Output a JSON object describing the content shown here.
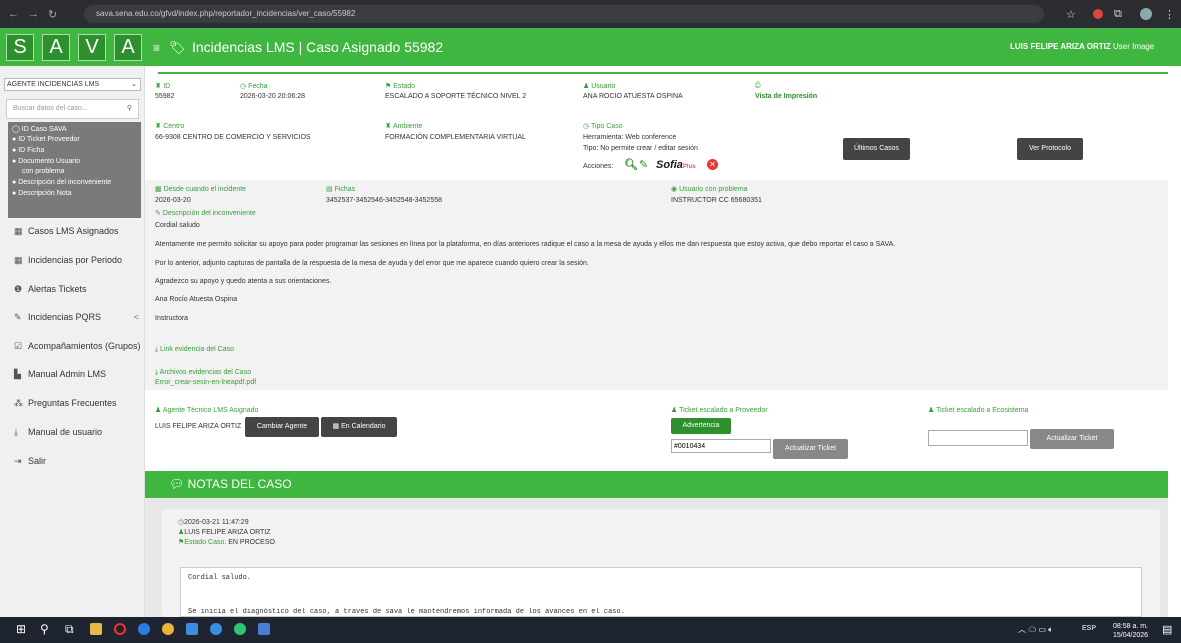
{
  "browser": {
    "url": "sava.sena.edu.co/gfvd/index.php/reportador_incidencias/ver_caso/55982"
  },
  "header": {
    "logo_letters": [
      "S",
      "A",
      "V",
      "A"
    ],
    "title": "Incidencias LMS | Caso Asignado 55982",
    "user": "LUIS FELIPE ARIZA ORTIZ",
    "user_image": "User Image"
  },
  "sidebar": {
    "select_value": "AGENTE INCIDENCIAS LMS",
    "search_placeholder": "Buscar datos del caso...",
    "radio_options": [
      "ID Caso SAVA",
      "ID Ticket Proveedor",
      "ID Ficha",
      "Documento Usuario",
      "con problema",
      "Descripción del inconveniente",
      "Descripción Nota"
    ],
    "menu": [
      "Casos LMS Asignados",
      "Incidencias por Periodo",
      "Alertas Tickets",
      "Incidencias PQRS",
      "Acompañamientos (Grupos)",
      "Manual Admin LMS",
      "Preguntas Frecuentes",
      "Manual de usuario",
      "Salir"
    ],
    "pqrs_caret": "<"
  },
  "case": {
    "id_label": "ID",
    "id": "55982",
    "fecha_label": "Fecha",
    "fecha": "2026-03-20 20:06:28",
    "estado_label": "Estado",
    "estado": "ESCALADO A SOPORTE TÉCNICO NIVEL 2",
    "usuario_label": "Usuario",
    "usuario": "ANA ROCIO ATUESTA OSPINA",
    "print_label": "Vista de Impresión",
    "centro_label": "Centro",
    "centro": "66-9308 CENTRO DE COMERCIO Y SERVICIOS",
    "ambiente_label": "Ambiente",
    "ambiente": "FORMACIÓN COMPLEMENTARIA VIRTUAL",
    "tipo_label": "Tipo Caso",
    "herramienta": "Herramienta: Web conference",
    "tipo": "Tipo: No permite crear / editar sesión",
    "acciones": "Acciones:",
    "sofia": "Sofia",
    "sofia_plus": "Plus",
    "btn_ultimos": "Últimos Casos",
    "btn_protocolo": "Ver Protocolo",
    "desde_label": "Desde cuando el incidente",
    "desde": "2026-03-20",
    "fichas_label": "Fichas",
    "fichas": "3452537-3452546-3452548-3452558",
    "usuario_problema_label": "Usuario con problema",
    "usuario_problema": "INSTRUCTOR CC 65680351",
    "descripcion_label": "Descripción del inconveniente",
    "descripcion": [
      "Cordial saludo",
      "Atentamente me permito solicitar su apoyo para poder programar las sesiones en línea por la plataforma, en días anteriores radique el caso a la mesa de ayuda y ellos me dan respuesta que estoy activa, que debo reportar el caso a SAVA.",
      "Por lo anterior, adjunto capturas de pantalla de la respuesta de la mesa de ayuda y del error que me aparece cuando quiero crear la sesión.",
      "Agradezco su apoyo y quedo atenta a sus orientaciones.",
      "Ana Rocío Atuesta Ospina",
      "Instructora"
    ],
    "link_label": "Link evidencia del Caso",
    "archivos_label": "Archivos evidencias del Caso",
    "archivo": "Error_crear-sesin-en-lneapdf.pdf",
    "agente_label": "Agente Técnico LMS Asignado",
    "agente": "LUIS FELIPE ARIZA ORTIZ",
    "btn_cambiar": "Cambiar Agente",
    "btn_calendario": "En Calendario",
    "ticket_prov_label": "Ticket escalado a Proveedor",
    "btn_advertencia": "Advertencia",
    "ticket_prov_value": "#0010434",
    "btn_actualizar": "Actualizar Ticket",
    "ticket_eco_label": "Ticket escalado a Ecosistema",
    "ticket_eco_value": "",
    "btn_actualizar2": "Actualizar Ticket"
  },
  "notes": {
    "header": "NOTAS DEL CASO",
    "date": "2026-03-21 11:47:29",
    "author": "LUIS FELIPE ARIZA ORTIZ",
    "estado_label": "Estado Caso:",
    "estado": "EN PROCESO",
    "body1": "Cordial saludo.",
    "body2": "Se inicia el diagnóstico del caso, a traves de sava le mantendremos informada de los avances en el caso."
  },
  "taskbar": {
    "lang": "ESP",
    "time": "08:58 a. m.",
    "date": "15/04/2026"
  },
  "colors": {
    "green": "#3fb63f",
    "dark_green": "#2e8f2e",
    "button": "#444444",
    "advertencia": "#2e8f2e"
  }
}
